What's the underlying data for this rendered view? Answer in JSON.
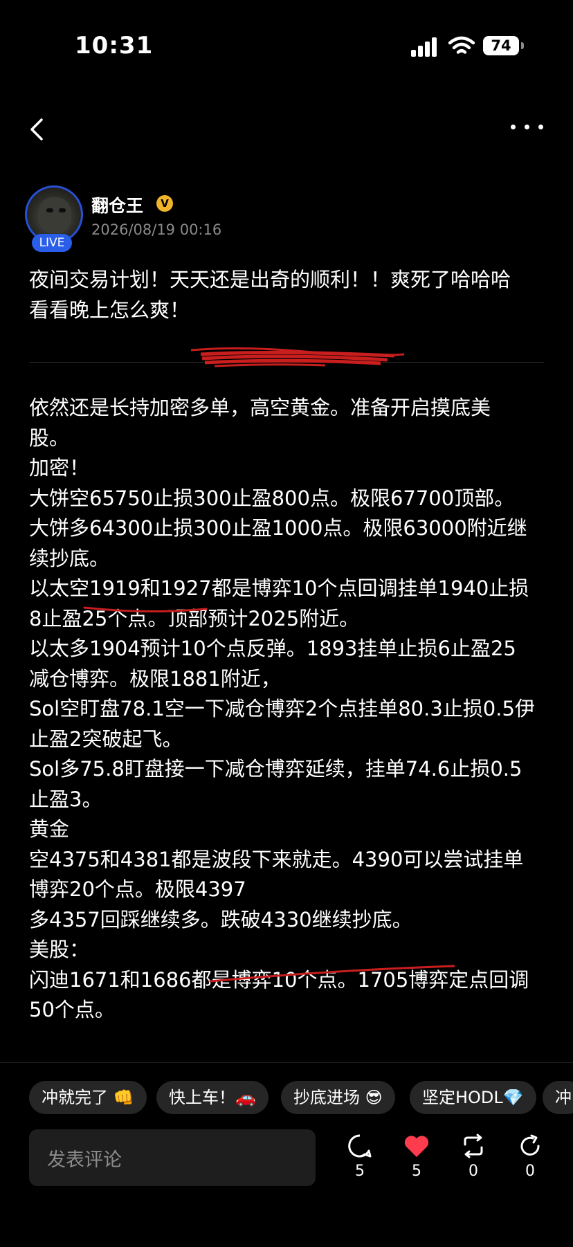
{
  "status_bar": {
    "time": "10:31",
    "battery": "74"
  },
  "author": {
    "name": "翻仓王",
    "verified": "V",
    "live_badge": "LIVE",
    "date": "2026/08/19 00:16"
  },
  "post": {
    "intro_lines": [
      "夜间交易计划！天天还是出奇的顺利！！爽死了哈哈哈",
      "看看晚上怎么爽！"
    ],
    "body_lines": [
      "依然还是长持加密多单，高空黄金。准备开启摸底美",
      "股。",
      "加密！",
      "大饼空65750止损300止盈800点。极限67700顶部。",
      "大饼多64300止损300止盈1000点。极限63000附近继",
      "续抄底。",
      "以太空1919和1927都是博弈10个点回调挂单1940止损",
      "8止盈25个点。顶部预计2025附近。",
      "以太多1904预计10个点反弹。1893挂单止损6止盈25",
      "减仓博弈。极限1881附近，",
      "Sol空盯盘78.1空一下减仓博弈2个点挂单80.3止损0.5伊",
      "止盈2突破起飞。",
      "Sol多75.8盯盘接一下减仓博弈延续，挂单74.6止损0.5",
      "止盈3。",
      "黄金",
      "空4375和4381都是波段下来就走。4390可以尝试挂单",
      "博弈20个点。极限4397",
      "多4357回踩继续多。跌破4330继续抄底。",
      "美股：",
      "闪迪1671和1686都是博弈10个点。1705博弈定点回调",
      "50个点。"
    ]
  },
  "quick_replies": [
    "冲就完了 👊",
    "快上车！🚗",
    "抄底进场 😎",
    "坚定HODL💎",
    "冲"
  ],
  "comment_input": {
    "placeholder": "发表评论"
  },
  "actions": {
    "comment_count": "5",
    "like_count": "5",
    "repost_count": "0",
    "share_count": "0"
  },
  "colors": {
    "accent_blue": "#2a5ee8",
    "like_red": "#ff3b4e",
    "verified_gold": "#f0b429",
    "annotation_red": "#c81e1e"
  }
}
